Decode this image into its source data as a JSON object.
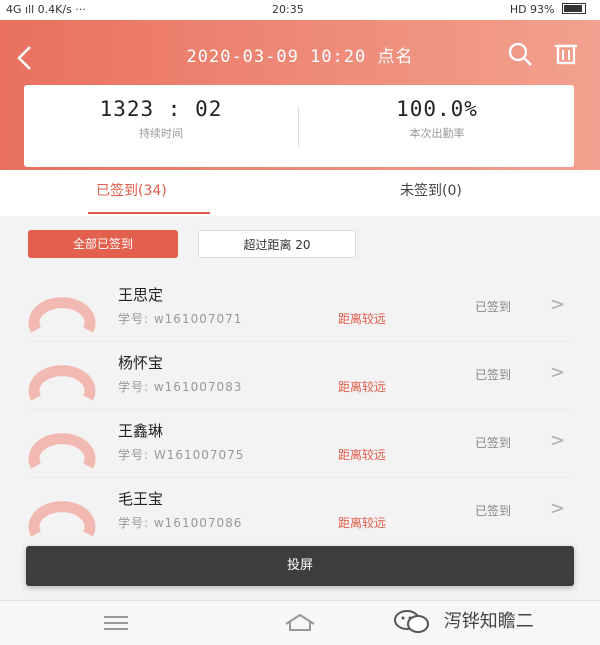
{
  "status_bar": {
    "left": "4G ıll 0.4K/s ···",
    "time": "20:35",
    "right": "HD 93%"
  },
  "header": {
    "title": "2020-03-09 10:20 点名",
    "icons": {
      "back": "back-arrow-icon",
      "search": "search-icon",
      "trash": "trash-icon"
    }
  },
  "stats": {
    "duration_value": "1323 : 02",
    "duration_label": "持续时间",
    "rate_value": "100.0%",
    "rate_label": "本次出勤率"
  },
  "tabs": [
    {
      "label": "已签到(34)",
      "active": true
    },
    {
      "label": "未签到(0)",
      "active": false
    }
  ],
  "filters": {
    "all_label": "全部已签到",
    "radius_label": "超过距离 20"
  },
  "students": [
    {
      "name": "王思定",
      "id": "学号: w161007071",
      "tag": "距离较远",
      "status": "已签到"
    },
    {
      "name": "杨怀宝",
      "id": "学号: w161007083",
      "tag": "距离较远",
      "status": "已签到"
    },
    {
      "name": "王鑫琳",
      "id": "学号: W161007075",
      "tag": "距离较远",
      "status": "已签到"
    },
    {
      "name": "毛王宝",
      "id": "学号: w161007086",
      "tag": "距离较远",
      "status": "已签到"
    }
  ],
  "action_button": "投屏",
  "watermark": "泻铧知瞻二",
  "colors": {
    "accent": "#e35c4b",
    "header_start": "#e9705e",
    "header_end": "#f3a190",
    "button_dark": "#3d3d3d"
  }
}
